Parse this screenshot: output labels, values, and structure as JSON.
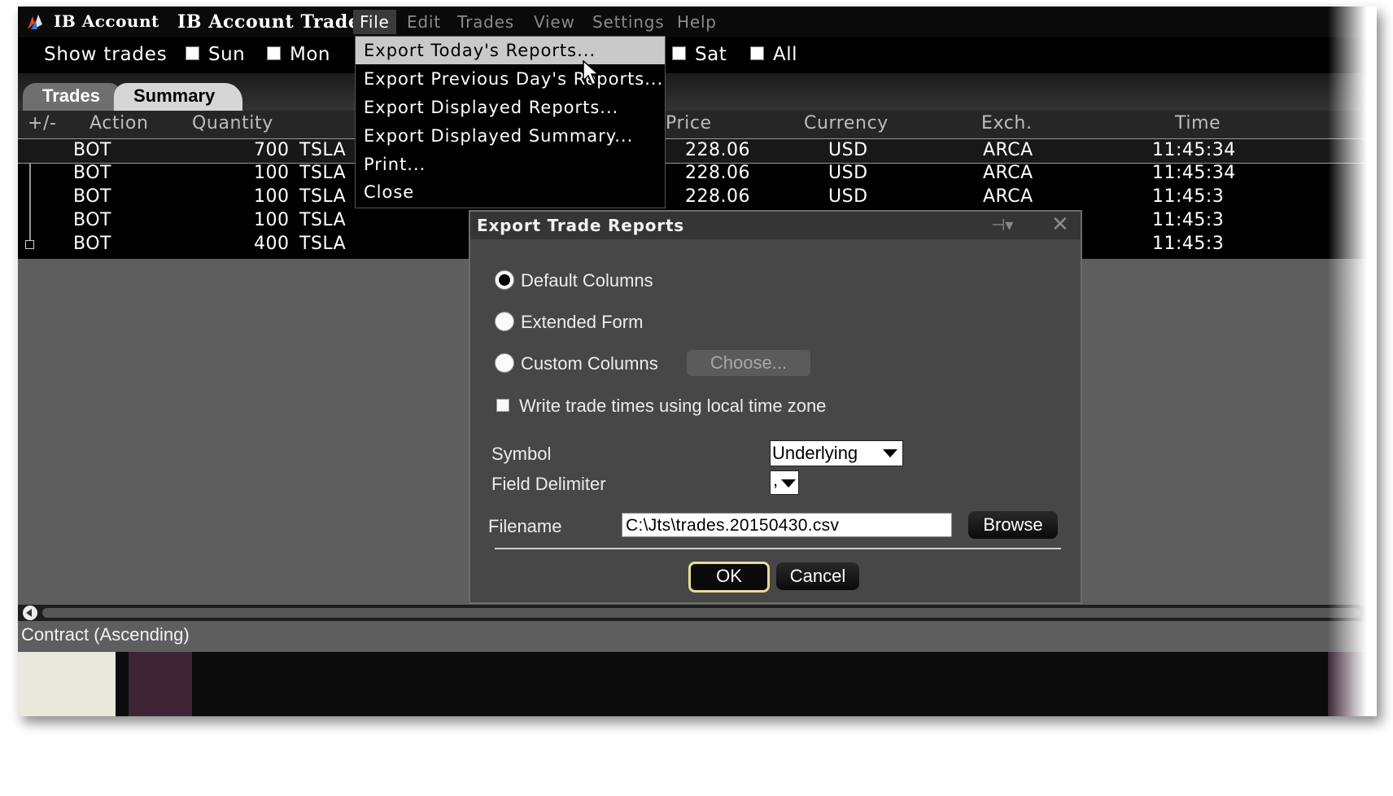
{
  "window": {
    "app_label": "IB Account",
    "title": "IB Account Trades"
  },
  "menubar": {
    "file": "File",
    "edit": "Edit",
    "trades": "Trades",
    "view": "View",
    "settings": "Settings",
    "help": "Help"
  },
  "filterbar": {
    "label": "Show trades",
    "days": [
      "Sun",
      "Mon",
      "Sat",
      "All"
    ]
  },
  "tabs": {
    "trades": "Trades",
    "summary": "Summary"
  },
  "columns": {
    "plus_minus": "+/-",
    "action": "Action",
    "quantity": "Quantity",
    "price": "Price",
    "currency": "Currency",
    "exchange": "Exch.",
    "time": "Time"
  },
  "rows": [
    {
      "action": "BOT",
      "quantity": "700",
      "symbol": "TSLA",
      "price": "228.06",
      "currency": "USD",
      "exchange": "ARCA",
      "time": "11:45:34"
    },
    {
      "action": "BOT",
      "quantity": "100",
      "symbol": "TSLA",
      "price": "228.06",
      "currency": "USD",
      "exchange": "ARCA",
      "time": "11:45:34"
    },
    {
      "action": "BOT",
      "quantity": "100",
      "symbol": "TSLA",
      "price": "228.06",
      "currency": "USD",
      "exchange": "ARCA",
      "time": "11:45:3"
    },
    {
      "action": "BOT",
      "quantity": "100",
      "symbol": "TSLA",
      "price": "",
      "currency": "",
      "exchange": "",
      "time": "11:45:3"
    },
    {
      "action": "BOT",
      "quantity": "400",
      "symbol": "TSLA",
      "price": "",
      "currency": "",
      "exchange": "",
      "time": "11:45:3"
    }
  ],
  "file_menu": {
    "items": [
      "Export Today's Reports...",
      "Export Previous Day's Reports...",
      "Export Displayed Reports...",
      "Export Displayed Summary...",
      "Print...",
      "Close"
    ]
  },
  "status": {
    "sort": "Contract (Ascending)"
  },
  "dialog": {
    "title": "Export Trade Reports",
    "radio_default": "Default Columns",
    "radio_extended": "Extended Form",
    "radio_custom": "Custom Columns",
    "choose_button": "Choose...",
    "write_times_label": "Write trade times using local time zone",
    "symbol_label": "Symbol",
    "symbol_value": "Underlying",
    "delimiter_label": "Field Delimiter",
    "delimiter_value": ",",
    "filename_label": "Filename",
    "filename_value": "C:\\Jts\\trades.20150430.csv",
    "browse_button": "Browse",
    "ok_button": "OK",
    "cancel_button": "Cancel"
  }
}
